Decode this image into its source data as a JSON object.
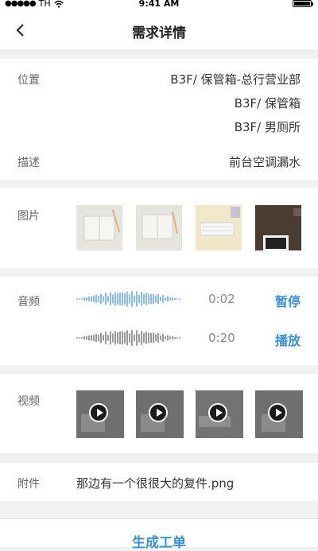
{
  "status_bar": {
    "carrier": "TH",
    "time": "9:41 AM"
  },
  "header": {
    "title": "需求详情"
  },
  "details": {
    "location_label": "位置",
    "locations": [
      "B3F/ 保管箱-总行营业部",
      "B3F/ 保管箱",
      "B3F/ 男厕所"
    ],
    "description_label": "描述",
    "description": "前台空调漏水"
  },
  "images": {
    "label": "图片",
    "items": [
      "notebook-photo",
      "notebook-photo",
      "keyboard-photo",
      "laptop-photo"
    ]
  },
  "audio": {
    "label": "音频",
    "tracks": [
      {
        "time": "0:02",
        "action": "暂停",
        "color": "#3a90d8"
      },
      {
        "time": "0:20",
        "action": "播放",
        "color": "#555555"
      }
    ]
  },
  "video": {
    "label": "视频",
    "items": [
      "video-thumbnail",
      "video-thumbnail",
      "video-thumbnail",
      "video-thumbnail"
    ]
  },
  "attachment": {
    "label": "附件",
    "filename": "那边有一个很很大的复件.png"
  },
  "footer": {
    "button": "生成工单"
  },
  "colors": {
    "accent": "#3a90d8",
    "background": "#f1f1f1"
  }
}
